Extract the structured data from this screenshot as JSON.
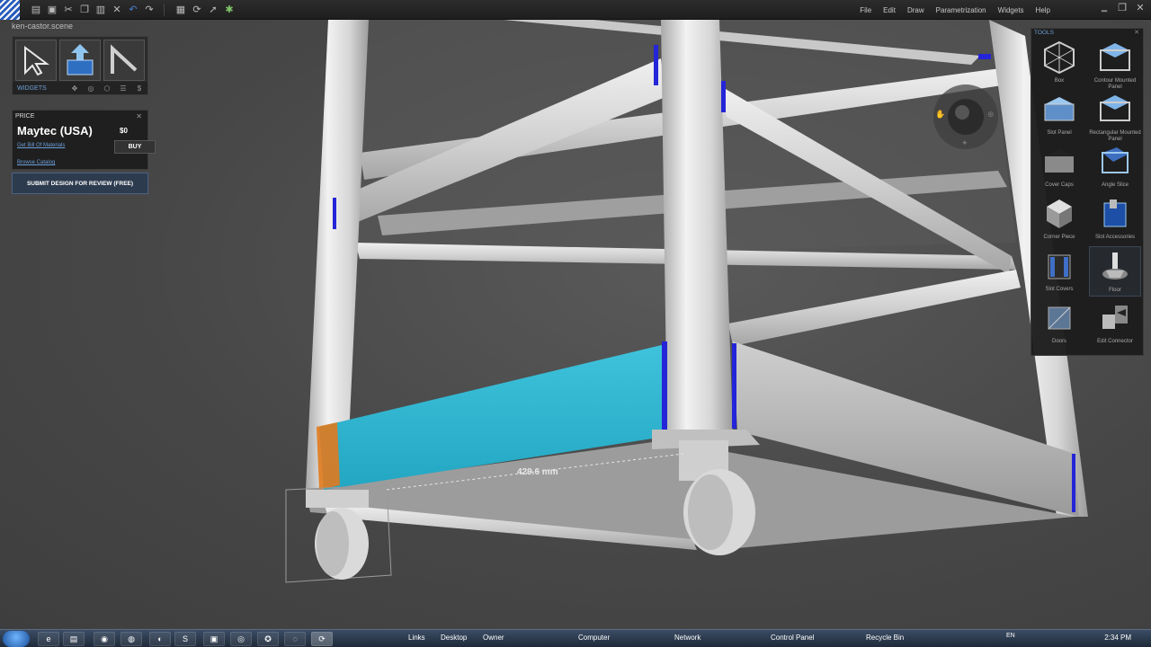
{
  "window": {
    "scene_name": "ken-castor.scene",
    "menu": [
      "File",
      "Edit",
      "Draw",
      "Parametrization",
      "Widgets",
      "Help"
    ]
  },
  "widgets_panel": {
    "label": "WIDGETS"
  },
  "price_panel": {
    "header": "PRICE",
    "vendor": "Maytec (USA)",
    "amount": "$0",
    "bom_link": "Get Bill Of Materials",
    "buy_label": "BUY",
    "catalog_link": "Browse Catalog"
  },
  "submit": {
    "label": "SUBMIT DESIGN FOR REVIEW (FREE)"
  },
  "tools": {
    "header": "TOOLS",
    "items": [
      {
        "label": "Box",
        "icon": "box-icon"
      },
      {
        "label": "Contour Mounted Panel",
        "icon": "contour-panel-icon"
      },
      {
        "label": "Slot Panel",
        "icon": "slot-panel-icon"
      },
      {
        "label": "Rectangular Mounted Panel",
        "icon": "rect-panel-icon"
      },
      {
        "label": "Cover Caps",
        "icon": "cover-caps-icon"
      },
      {
        "label": "Angle Slice",
        "icon": "angle-slice-icon"
      },
      {
        "label": "Corner Piece",
        "icon": "corner-piece-icon"
      },
      {
        "label": "Slot Accessories",
        "icon": "slot-accessories-icon"
      },
      {
        "label": "Slot Covers",
        "icon": "slot-covers-icon"
      },
      {
        "label": "Floor",
        "icon": "floor-icon",
        "selected": true
      },
      {
        "label": "Doors",
        "icon": "doors-icon"
      },
      {
        "label": "Edit Connector",
        "icon": "edit-connector-icon"
      }
    ]
  },
  "viewport": {
    "measurement": "429.6 mm",
    "highlight_color": "#33b5d0",
    "endcap_color": "#e07a1e",
    "accent_color": "#2424d8"
  },
  "taskbar": {
    "links": [
      "Links",
      "Desktop",
      "Owner",
      "Computer",
      "Network",
      "Control Panel",
      "Recycle Bin"
    ],
    "lang": "EN",
    "time": "2:34 PM"
  }
}
